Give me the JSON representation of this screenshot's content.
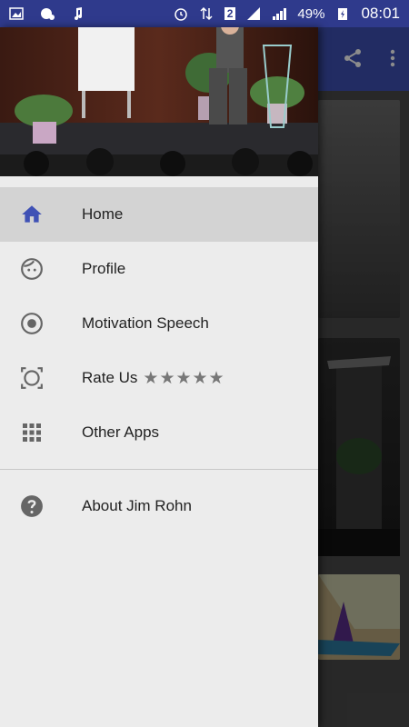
{
  "status_bar": {
    "battery": "49%",
    "time": "08:01",
    "sim": "2"
  },
  "drawer": {
    "items": [
      {
        "label": "Home",
        "icon": "home-icon",
        "active": true
      },
      {
        "label": "Profile",
        "icon": "face-icon"
      },
      {
        "label": "Motivation Speech",
        "icon": "radio-button-icon"
      },
      {
        "label": "Rate Us",
        "icon": "rate-icon",
        "stars": "★★★★★"
      },
      {
        "label": "Other Apps",
        "icon": "apps-grid-icon"
      }
    ],
    "secondary_items": [
      {
        "label": "About Jim Rohn",
        "icon": "help-icon"
      }
    ]
  },
  "colors": {
    "status_bar": "#2f3a8c",
    "app_bar": "#3f51b5",
    "active_icon": "#3f51b5",
    "drawer_bg": "#ececec",
    "active_row": "#d3d3d3"
  }
}
